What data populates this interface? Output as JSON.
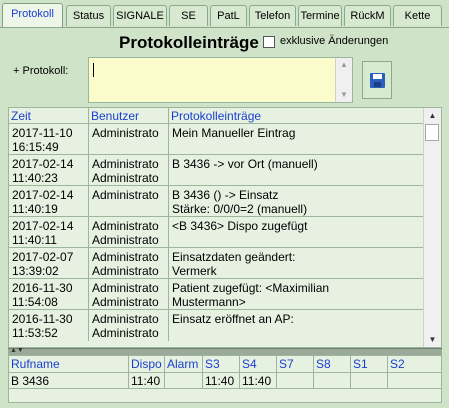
{
  "tabs": [
    {
      "label": "Protokoll",
      "active": true
    },
    {
      "label": "Status"
    },
    {
      "label": "SIGNALE"
    },
    {
      "label": "SE"
    },
    {
      "label": "PatL"
    },
    {
      "label": "Telefon"
    },
    {
      "label": "Termine"
    },
    {
      "label": "RückM"
    },
    {
      "label": "Kette"
    }
  ],
  "header": {
    "title": "Protokolleinträge",
    "exclusive_label": "exklusive Änderungen",
    "exclusive_checked": false
  },
  "entry": {
    "label": "+ Protokoll:",
    "value": ""
  },
  "log": {
    "columns": [
      "Zeit",
      "Benutzer",
      "Protokolleinträge"
    ],
    "rows": [
      {
        "date": "2017-11-10",
        "time": "16:15:49",
        "user1": "Administrato",
        "user2": "",
        "text1": "Mein Manueller Eintrag",
        "text2": ""
      },
      {
        "date": "2017-02-14",
        "time": "11:40:23",
        "user1": "Administrato",
        "user2": "Administrato",
        "text1": "B 3436 -> vor Ort (manuell)",
        "text2": ""
      },
      {
        "date": "2017-02-14",
        "time": "11:40:19",
        "user1": "Administrato",
        "user2": "",
        "text1": "B 3436 () -> Einsatz",
        "text2": "Stärke: 0/0/0=2 (manuell)"
      },
      {
        "date": "2017-02-14",
        "time": "11:40:11",
        "user1": "Administrato",
        "user2": "Administrato",
        "text1": "<B 3436> Dispo zugefügt",
        "text2": ""
      },
      {
        "date": "2017-02-07",
        "time": "13:39:02",
        "user1": "Administrato",
        "user2": "Administrato",
        "text1": "Einsatzdaten geändert:",
        "text2": "Vermerk"
      },
      {
        "date": "2016-11-30",
        "time": "11:54:08",
        "user1": "Administrato",
        "user2": "Administrato",
        "text1": "Patient zugefügt: <Maximilian",
        "text2": "Mustermann>"
      },
      {
        "date": "2016-11-30",
        "time": "11:53:52",
        "user1": "Administrato",
        "user2": "Administrato",
        "text1": "Einsatz eröffnet an AP:",
        "text2": ""
      }
    ]
  },
  "units": {
    "columns": [
      "Rufname",
      "Dispo",
      "Alarm",
      "S3",
      "S4",
      "S7",
      "S8",
      "S1",
      "S2"
    ],
    "rows": [
      [
        "B 3436",
        "11:40",
        "",
        "11:40",
        "11:40",
        "",
        "",
        "",
        ""
      ]
    ]
  }
}
